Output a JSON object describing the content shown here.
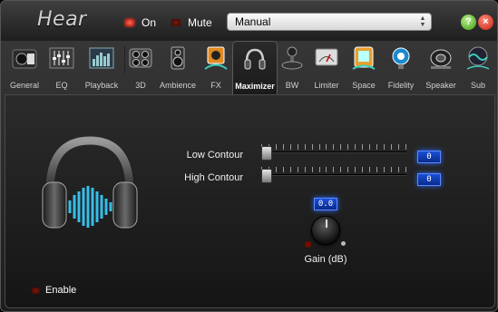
{
  "app": {
    "logo_text": "Hear"
  },
  "titlebar": {
    "on_label": "On",
    "mute_label": "Mute",
    "preset_value": "Manual",
    "help_glyph": "?",
    "close_glyph": "×"
  },
  "tabs": [
    {
      "label": "General",
      "icon": "speaker-doc-icon"
    },
    {
      "label": "EQ",
      "icon": "eq-icon"
    },
    {
      "label": "Playback",
      "icon": "playback-bars-icon"
    },
    {
      "label": "3D",
      "icon": "speakers-3d-icon"
    },
    {
      "label": "Ambience",
      "icon": "ambience-speaker-icon"
    },
    {
      "label": "FX",
      "icon": "fx-icon"
    },
    {
      "label": "Maximizer",
      "icon": "headphones-icon",
      "active": true
    },
    {
      "label": "BW",
      "icon": "joystick-icon"
    },
    {
      "label": "Limiter",
      "icon": "meter-icon"
    },
    {
      "label": "Space",
      "icon": "space-icon"
    },
    {
      "label": "Fidelity",
      "icon": "fidelity-icon"
    },
    {
      "label": "Speaker",
      "icon": "speaker-disc-icon"
    },
    {
      "label": "Sub",
      "icon": "sub-wave-icon"
    }
  ],
  "maximizer": {
    "low_contour_label": "Low Contour",
    "low_contour_value": "0",
    "high_contour_label": "High Contour",
    "high_contour_value": "0",
    "gain_value": "0.0",
    "gain_label": "Gain (dB)",
    "enable_label": "Enable"
  },
  "colors": {
    "accent_blue": "#1a4fd6",
    "led_red": "#ff3a2a"
  }
}
